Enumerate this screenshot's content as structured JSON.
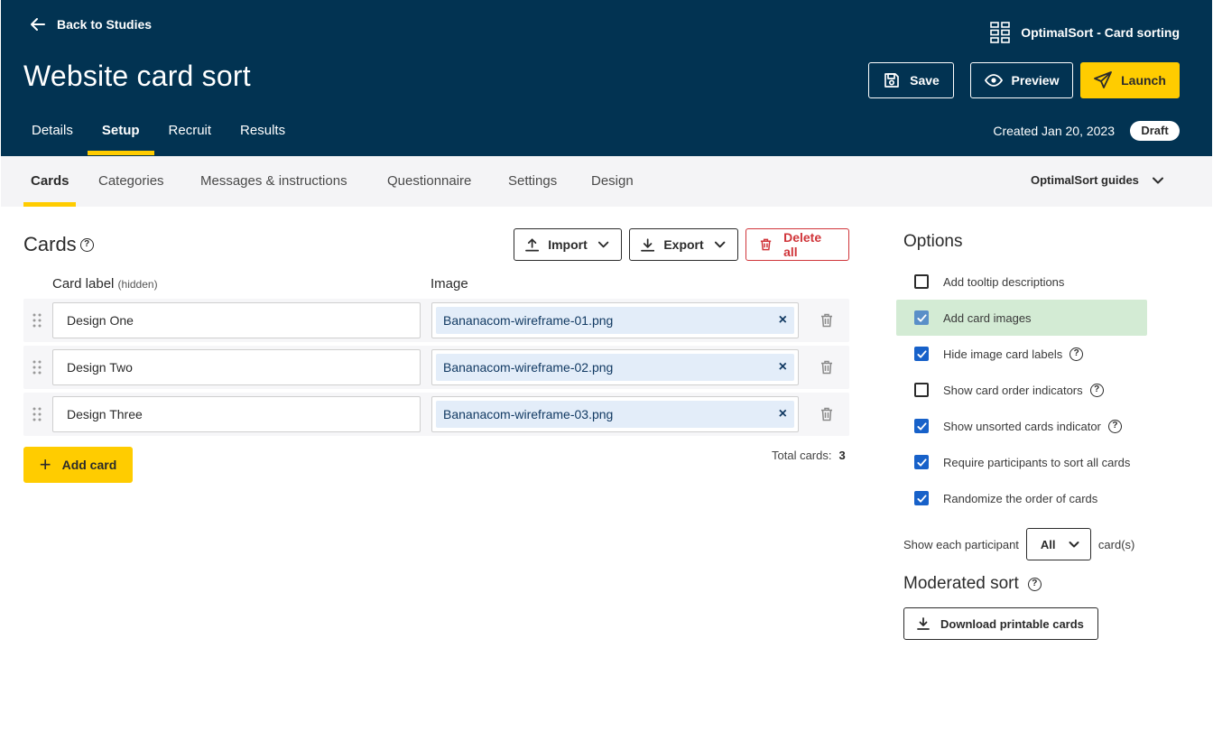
{
  "header": {
    "back_label": "Back to Studies",
    "product_label": "OptimalSort - Card sorting",
    "title": "Website card sort",
    "save_label": "Save",
    "preview_label": "Preview",
    "launch_label": "Launch",
    "nav": [
      "Details",
      "Setup",
      "Recruit",
      "Results"
    ],
    "created": "Created Jan 20, 2023",
    "status": "Draft"
  },
  "subnav": {
    "tabs": [
      "Cards",
      "Categories",
      "Messages & instructions",
      "Questionnaire",
      "Settings",
      "Design"
    ],
    "guides_label": "OptimalSort guides"
  },
  "cards": {
    "title": "Cards",
    "help": "?",
    "import_label": "Import",
    "export_label": "Export",
    "delete_label": "Delete all",
    "col_label": "Card label",
    "col_label_hint": "(hidden)",
    "col_image": "Image",
    "rows": [
      {
        "label": "Design One",
        "image": "Bananacom-wireframe-01.png"
      },
      {
        "label": "Design Two",
        "image": "Bananacom-wireframe-02.png"
      },
      {
        "label": "Design Three",
        "image": "Bananacom-wireframe-03.png"
      }
    ],
    "remove_glyph": "×",
    "add_label": "Add card",
    "add_glyph": "+",
    "total_label": "Total cards:",
    "total_value": "3"
  },
  "options": {
    "title": "Options",
    "items": [
      {
        "label": "Add tooltip descriptions",
        "checked": false
      },
      {
        "label": "Add card images",
        "checked": true
      },
      {
        "label": "Hide image card labels",
        "checked": true
      },
      {
        "label": "Show card order indicators",
        "checked": false
      },
      {
        "label": "Show unsorted cards indicator",
        "checked": true
      },
      {
        "label": "Require participants to sort all cards",
        "checked": true
      },
      {
        "label": "Randomize the order of cards",
        "checked": true
      }
    ],
    "show_each_prefix": "Show each participant",
    "show_each_value": "All",
    "show_each_suffix": "card(s)",
    "moderated_title": "Moderated sort",
    "download_label": "Download printable cards"
  },
  "colors": {
    "header_bg": "#023352",
    "accent_yellow": "#ffcc00",
    "delete_red": "#d0353a",
    "checkbox_blue": "#1761c9",
    "highlight_green": "#d3ebd4"
  }
}
